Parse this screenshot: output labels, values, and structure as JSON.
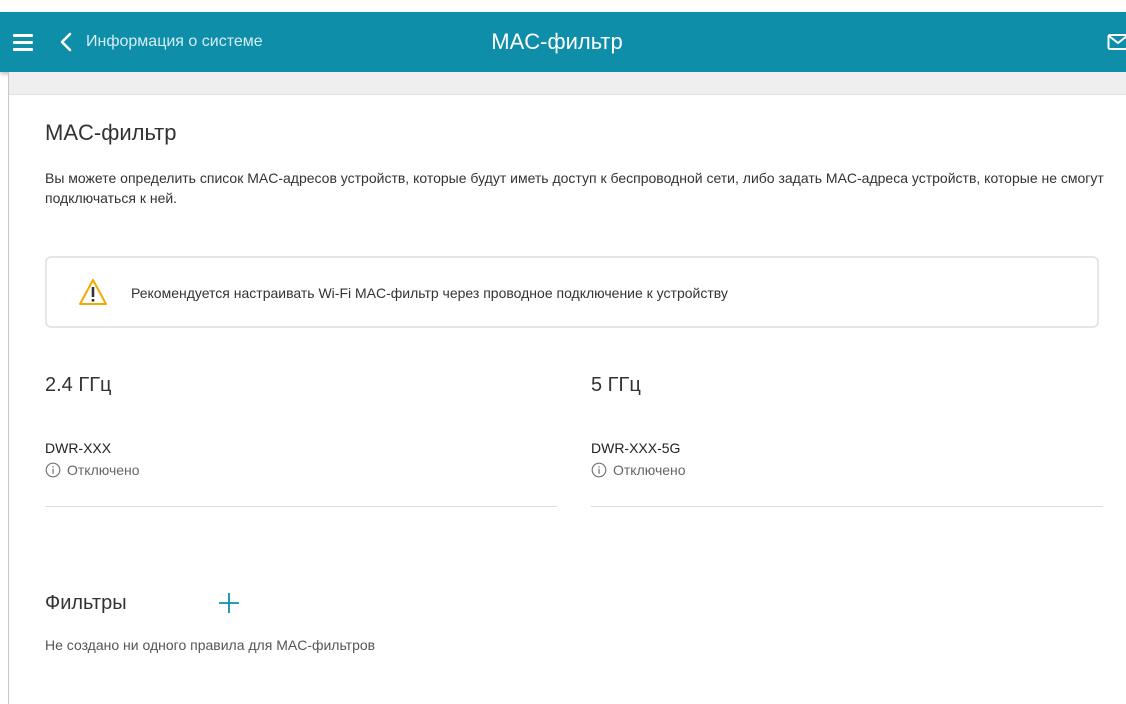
{
  "header": {
    "back_label": "Информация о системе",
    "title": "MAC-фильтр",
    "background_color": "#0e8ea9",
    "icons": {
      "menu": "hamburger-menu-icon",
      "back": "chevron-left-icon",
      "notifications": "mail-icon"
    }
  },
  "main": {
    "section_title": "MAC-фильтр",
    "description": "Вы можете определить список MAC-адресов устройств, которые будут иметь доступ к беспроводной сети, либо задать MAC-адреса устройств, которые не смогут подключаться к ней.",
    "warning": {
      "icon": "warning-triangle-icon",
      "text": "Рекомендуется настраивать Wi-Fi MAC-фильтр через проводное подключение к устройству"
    },
    "bands": [
      {
        "title": "2.4 ГГц",
        "ssid": "DWR-XXX",
        "status": "Отключено",
        "status_icon": "info-icon"
      },
      {
        "title": "5 ГГц",
        "ssid": "DWR-XXX-5G",
        "status": "Отключено",
        "status_icon": "info-icon"
      }
    ],
    "filters": {
      "title": "Фильтры",
      "add_icon": "plus-icon",
      "empty_text": "Не создано ни одного правила для MAC-фильтров"
    }
  }
}
